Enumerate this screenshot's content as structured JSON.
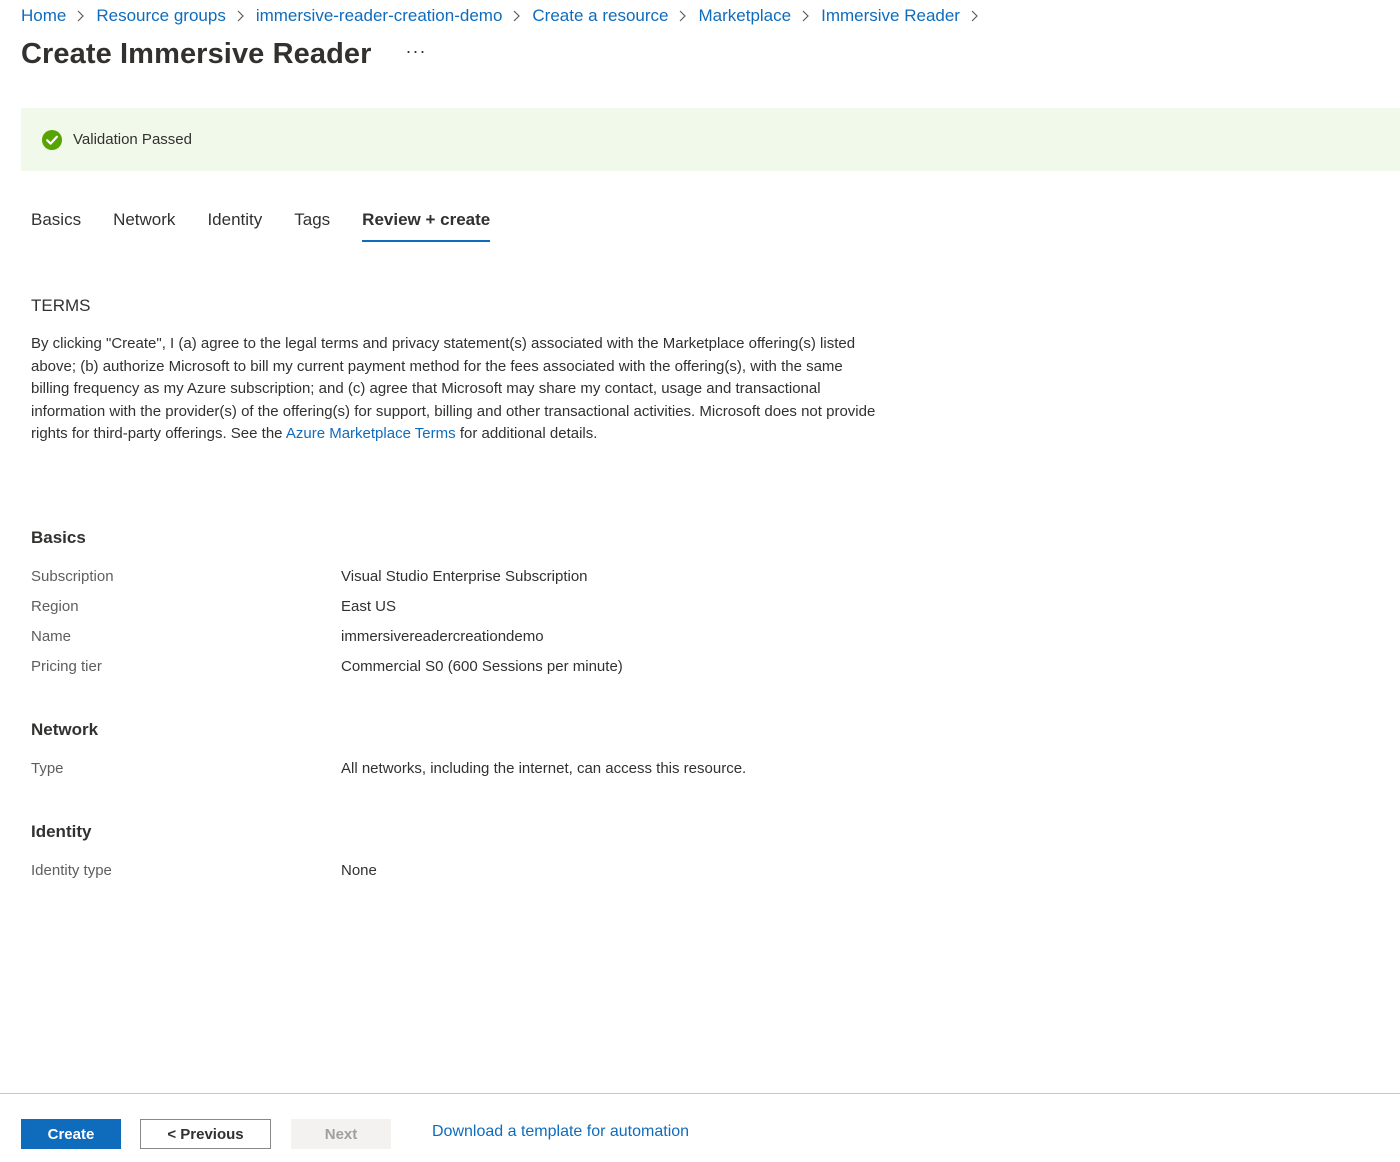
{
  "breadcrumb": {
    "items": [
      {
        "label": "Home"
      },
      {
        "label": "Resource groups"
      },
      {
        "label": "immersive-reader-creation-demo"
      },
      {
        "label": "Create a resource"
      },
      {
        "label": "Marketplace"
      },
      {
        "label": "Immersive Reader"
      }
    ]
  },
  "header": {
    "title": "Create Immersive Reader",
    "more_label": "···"
  },
  "banner": {
    "text": "Validation Passed",
    "icon": "check-circle-icon",
    "color": "#57a300",
    "background": "#f1f9ea"
  },
  "tabs": [
    {
      "label": "Basics",
      "active": false
    },
    {
      "label": "Network",
      "active": false
    },
    {
      "label": "Identity",
      "active": false
    },
    {
      "label": "Tags",
      "active": false
    },
    {
      "label": "Review + create",
      "active": true
    }
  ],
  "terms": {
    "heading": "TERMS",
    "text_before": "By clicking \"Create\", I (a) agree to the legal terms and privacy statement(s) associated with the Marketplace offering(s) listed above; (b) authorize Microsoft to bill my current payment method for the fees associated with the offering(s), with the same billing frequency as my Azure subscription; and (c) agree that Microsoft may share my contact, usage and transactional information with the provider(s) of the offering(s) for support, billing and other transactional activities. Microsoft does not provide rights for third-party offerings. See the ",
    "link": "Azure Marketplace Terms",
    "text_after": " for additional details."
  },
  "sections": {
    "basics": {
      "heading": "Basics",
      "rows": [
        {
          "label": "Subscription",
          "value": "Visual Studio Enterprise Subscription"
        },
        {
          "label": "Region",
          "value": "East US"
        },
        {
          "label": "Name",
          "value": "immersivereadercreationdemo"
        },
        {
          "label": "Pricing tier",
          "value": "Commercial S0 (600 Sessions per minute)"
        }
      ]
    },
    "network": {
      "heading": "Network",
      "rows": [
        {
          "label": "Type",
          "value": "All networks, including the internet, can access this resource."
        }
      ]
    },
    "identity": {
      "heading": "Identity",
      "rows": [
        {
          "label": "Identity type",
          "value": "None"
        }
      ]
    }
  },
  "footer": {
    "create_label": "Create",
    "previous_label": "< Previous",
    "next_label": "Next",
    "template_link": "Download a template for automation"
  },
  "colors": {
    "accent": "#0f6cbd",
    "text": "#323130",
    "muted": "#605e5c"
  }
}
